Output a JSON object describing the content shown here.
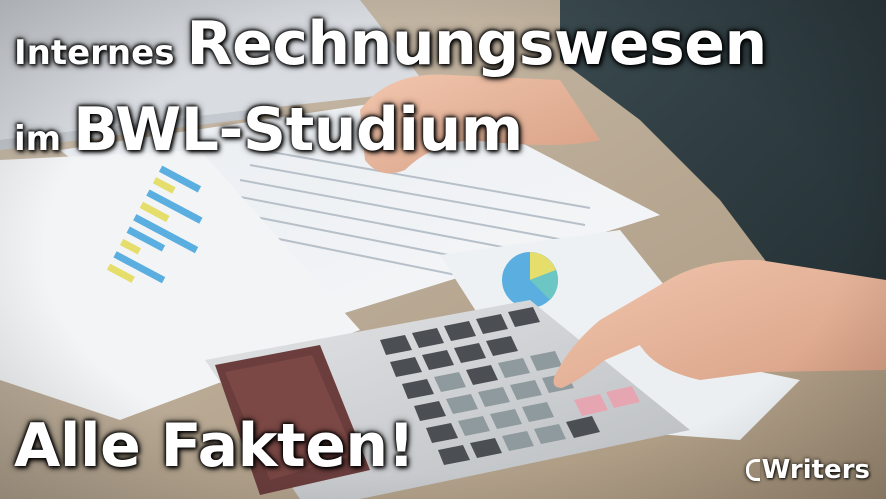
{
  "headline": {
    "line1_small": "Internes",
    "line1_big": "Rechnungswesen",
    "line2_small": "im",
    "line2_big": "BWL-Studium",
    "line3": "Alle Fakten!"
  },
  "logo": {
    "text": "Writers",
    "icon": "c-mark-icon"
  },
  "colors": {
    "headline_text": "#ffffff",
    "desk": "#b9aa96",
    "paper": "#eef1f4",
    "chart_blue": "#5aaee0",
    "chart_yellow": "#e5de6a",
    "calculator_body": "#d4d6d8",
    "key_dark": "#4b4f54",
    "key_pink": "#e6a6b1",
    "sweater": "#2f3e42",
    "skin": "#e9b79f"
  }
}
